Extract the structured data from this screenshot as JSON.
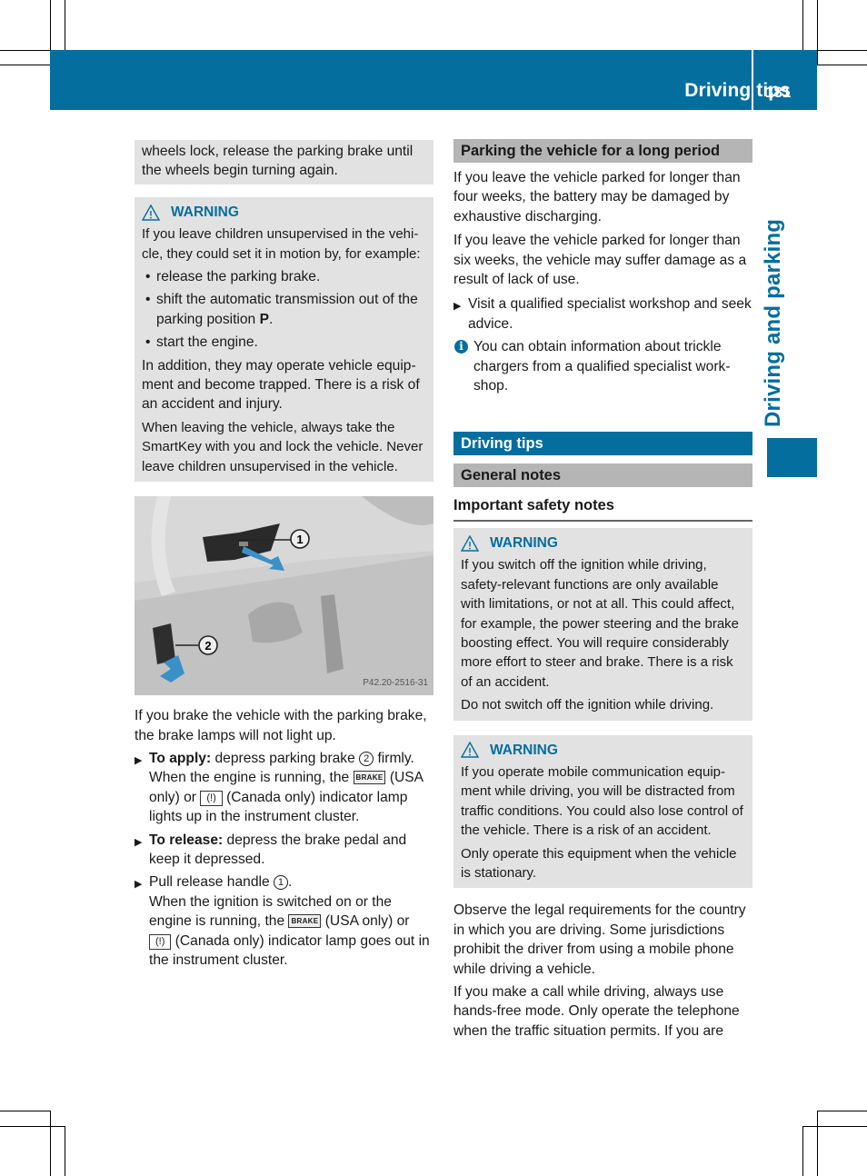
{
  "header": {
    "title": "Driving tips",
    "page_number": "181",
    "side_tab": "Driving and parking",
    "brand_color": "#046e9e"
  },
  "left": {
    "continued_box": "wheels lock, release the parking brake until the wheels begin turning again.",
    "warning1": {
      "label": "WARNING",
      "intro": "If you leave children unsupervised in the vehi­cle, they could set it in motion by, for example:",
      "bullets": [
        "release the parking brake.",
        "shift the automatic transmission out of the parking position",
        "start the engine."
      ],
      "bullet2_bold": "P",
      "para1": "In addition, they may operate vehicle equip­ment and become trapped. There is a risk of an accident and injury.",
      "para2": "When leaving the vehicle, always take the SmartKey with you and lock the vehicle. Never leave children unsupervised in the vehicle."
    },
    "figure": {
      "code": "P42.20-2516-31",
      "callout1": "1",
      "callout2": "2",
      "icon": "parking-brake-pedal-illustration"
    },
    "intro": "If you brake the vehicle with the parking brake, the brake lamps will not light up.",
    "steps": {
      "apply_label": "To apply:",
      "apply_text1": " depress parking brake ",
      "apply_num": "2",
      "apply_text2": " firmly. When the engine is running, the ",
      "brake_lamp": "BRAKE",
      "apply_text3": " (USA only) or ",
      "canada_lamp": "(!)",
      "apply_text4": " (Canada only) indicator lamp lights up in the instrument cluster.",
      "release_label": "To release:",
      "release_text": " depress the brake pedal and keep it depressed.",
      "pull_text1": "Pull release handle ",
      "pull_num": "1",
      "pull_text2": ".",
      "pull_text3": "When the ignition is switched on or the engine is running, the ",
      "pull_text4": " (USA only) or ",
      "pull_text5": " (Canada only) indicator lamp goes out in the instrument cluster."
    }
  },
  "right": {
    "section_parking": "Parking the vehicle for a long period",
    "parking_p1": "If you leave the vehicle parked for longer than four weeks, the battery may be damaged by exhaustive discharging.",
    "parking_p2": "If you leave the vehicle parked for longer than six weeks, the vehicle may suffer damage as a result of lack of use.",
    "parking_step": "Visit a qualified specialist workshop and seek advice.",
    "parking_info": "You can obtain information about trickle chargers from a qualified specialist work­shop.",
    "section_driving_tips": "Driving tips",
    "section_general_notes": "General notes",
    "subhead_safety": "Important safety notes",
    "warning2": {
      "label": "WARNING",
      "text": "If you switch off the ignition while driving, safety-relevant functions are only available with limitations, or not at all. This could affect, for example, the power steering and the brake boosting effect. You will require considerably more effort to steer and brake. There is a risk of an accident.",
      "text2": "Do not switch off the ignition while driving."
    },
    "warning3": {
      "label": "WARNING",
      "text": "If you operate mobile communication equip­ment while driving, you will be distracted from traffic conditions. You could also lose control of the vehicle. There is a risk of an accident.",
      "text2": "Only operate this equipment when the vehicle is stationary."
    },
    "para_legal": "Observe the legal requirements for the coun­try in which you are driving. Some jurisdic­tions prohibit the driver from using a mobile phone while driving a vehicle.",
    "para_call": "If you make a call while driving, always use hands-free mode. Only operate the telephone when the traffic situation permits. If you are"
  }
}
